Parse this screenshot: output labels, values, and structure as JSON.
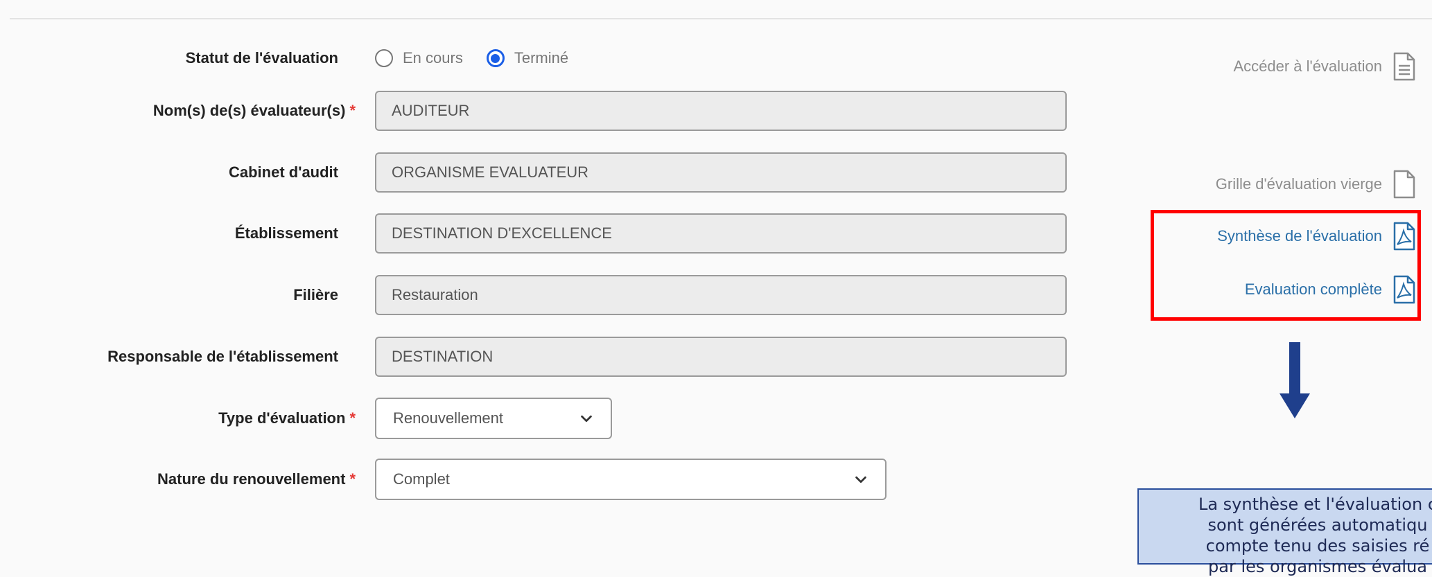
{
  "form": {
    "status": {
      "label": "Statut de l'évaluation",
      "options": [
        {
          "label": "En cours",
          "selected": false
        },
        {
          "label": "Terminé",
          "selected": true
        }
      ]
    },
    "evaluators": {
      "label": "Nom(s) de(s) évaluateur(s)",
      "required_mark": "*",
      "value": "AUDITEUR"
    },
    "audit_firm": {
      "label": "Cabinet d'audit",
      "value": "ORGANISME EVALUATEUR"
    },
    "establishment": {
      "label": "Établissement",
      "value": "DESTINATION D'EXCELLENCE"
    },
    "sector": {
      "label": "Filière",
      "value": "Restauration"
    },
    "manager": {
      "label": "Responsable de l'établissement",
      "value": "DESTINATION"
    },
    "evaluation_type": {
      "label": "Type d'évaluation",
      "required_mark": "*",
      "value": "Renouvellement"
    },
    "renewal_nature": {
      "label": "Nature du renouvellement",
      "required_mark": "*",
      "value": "Complet"
    }
  },
  "side_links": {
    "access": "Accéder à l'évaluation",
    "blank_grid": "Grille d'évaluation vierge",
    "synthesis": "Synthèse de l'évaluation",
    "full": "Evaluation complète"
  },
  "note": {
    "lines": [
      "La synthèse et l'évaluation c",
      "sont générées automatiqu",
      "compte tenu des saisies ré",
      "par les organismes évalua"
    ]
  },
  "colors": {
    "accent_blue": "#1a5ee6",
    "link_blue": "#2a6fa8",
    "required_red": "#e53935",
    "highlight_red": "#ff0000",
    "note_bg": "#c9d8f0",
    "arrow_navy": "#1f3f8c"
  }
}
